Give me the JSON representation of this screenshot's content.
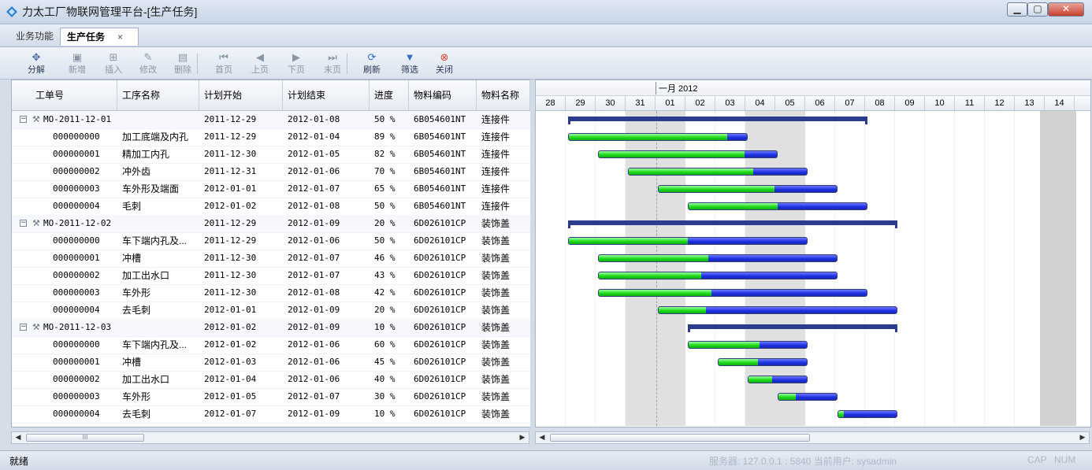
{
  "window": {
    "title": "力太工厂物联网管理平台-[生产任务]",
    "min": "▁",
    "max": "▢",
    "close": "✕"
  },
  "tabs": [
    {
      "label": "业务功能"
    },
    {
      "label": "生产任务",
      "close": "×"
    }
  ],
  "toolbar": [
    {
      "label": "分解",
      "icon": "split-icon",
      "enabled": true
    },
    {
      "label": "新增",
      "icon": "add-icon",
      "enabled": false
    },
    {
      "label": "插入",
      "icon": "insert-icon",
      "enabled": false
    },
    {
      "label": "修改",
      "icon": "edit-icon",
      "enabled": false
    },
    {
      "label": "删除",
      "icon": "delete-icon",
      "enabled": false
    },
    {
      "label": "首页",
      "icon": "first-page-icon",
      "enabled": false
    },
    {
      "label": "上页",
      "icon": "prev-page-icon",
      "enabled": false
    },
    {
      "label": "下页",
      "icon": "next-page-icon",
      "enabled": false
    },
    {
      "label": "末页",
      "icon": "last-page-icon",
      "enabled": false
    },
    {
      "label": "刷新",
      "icon": "refresh-icon",
      "enabled": true
    },
    {
      "label": "筛选",
      "icon": "filter-icon",
      "enabled": true
    },
    {
      "label": "关闭",
      "icon": "close-circle-icon",
      "enabled": true
    }
  ],
  "grid": {
    "columns": [
      "工单号",
      "工序名称",
      "计划开始",
      "计划结束",
      "进度",
      "物料编码",
      "物料名称"
    ],
    "rows": [
      {
        "type": "parent",
        "id": "MO-2011-12-01",
        "name": "",
        "start": "2011-12-29",
        "end": "2012-01-08",
        "progress": "50 %",
        "code": "6B054601NT",
        "material": "连接件",
        "s": 29,
        "e": 39,
        "pct": 50
      },
      {
        "type": "child",
        "id": "000000000",
        "name": "加工底端及内孔",
        "start": "2011-12-29",
        "end": "2012-01-04",
        "progress": "89 %",
        "code": "6B054601NT",
        "material": "连接件",
        "s": 29,
        "e": 35,
        "pct": 89
      },
      {
        "type": "child",
        "id": "000000001",
        "name": "精加工内孔",
        "start": "2011-12-30",
        "end": "2012-01-05",
        "progress": "82 %",
        "code": "6B054601NT",
        "material": "连接件",
        "s": 30,
        "e": 36,
        "pct": 82
      },
      {
        "type": "child",
        "id": "000000002",
        "name": "冲外齿",
        "start": "2011-12-31",
        "end": "2012-01-06",
        "progress": "70 %",
        "code": "6B054601NT",
        "material": "连接件",
        "s": 31,
        "e": 37,
        "pct": 70
      },
      {
        "type": "child",
        "id": "000000003",
        "name": "车外形及端面",
        "start": "2012-01-01",
        "end": "2012-01-07",
        "progress": "65 %",
        "code": "6B054601NT",
        "material": "连接件",
        "s": 32,
        "e": 38,
        "pct": 65
      },
      {
        "type": "child",
        "id": "000000004",
        "name": "毛刺",
        "start": "2012-01-02",
        "end": "2012-01-08",
        "progress": "50 %",
        "code": "6B054601NT",
        "material": "连接件",
        "s": 33,
        "e": 39,
        "pct": 50
      },
      {
        "type": "parent",
        "id": "MO-2011-12-02",
        "name": "",
        "start": "2011-12-29",
        "end": "2012-01-09",
        "progress": "20 %",
        "code": "6D026101CP",
        "material": "装饰盖",
        "s": 29,
        "e": 40,
        "pct": 20
      },
      {
        "type": "child",
        "id": "000000000",
        "name": "车下端内孔及...",
        "start": "2011-12-29",
        "end": "2012-01-06",
        "progress": "50 %",
        "code": "6D026101CP",
        "material": "装饰盖",
        "s": 29,
        "e": 37,
        "pct": 50
      },
      {
        "type": "child",
        "id": "000000001",
        "name": "冲槽",
        "start": "2011-12-30",
        "end": "2012-01-07",
        "progress": "46 %",
        "code": "6D026101CP",
        "material": "装饰盖",
        "s": 30,
        "e": 38,
        "pct": 46
      },
      {
        "type": "child",
        "id": "000000002",
        "name": "加工出水口",
        "start": "2011-12-30",
        "end": "2012-01-07",
        "progress": "43 %",
        "code": "6D026101CP",
        "material": "装饰盖",
        "s": 30,
        "e": 38,
        "pct": 43
      },
      {
        "type": "child",
        "id": "000000003",
        "name": "车外形",
        "start": "2011-12-30",
        "end": "2012-01-08",
        "progress": "42 %",
        "code": "6D026101CP",
        "material": "装饰盖",
        "s": 30,
        "e": 39,
        "pct": 42
      },
      {
        "type": "child",
        "id": "000000004",
        "name": "去毛刺",
        "start": "2012-01-01",
        "end": "2012-01-09",
        "progress": "20 %",
        "code": "6D026101CP",
        "material": "装饰盖",
        "s": 32,
        "e": 40,
        "pct": 20
      },
      {
        "type": "parent",
        "id": "MO-2011-12-03",
        "name": "",
        "start": "2012-01-02",
        "end": "2012-01-09",
        "progress": "10 %",
        "code": "6D026101CP",
        "material": "装饰盖",
        "s": 33,
        "e": 40,
        "pct": 10
      },
      {
        "type": "child",
        "id": "000000000",
        "name": "车下端内孔及...",
        "start": "2012-01-02",
        "end": "2012-01-06",
        "progress": "60 %",
        "code": "6D026101CP",
        "material": "装饰盖",
        "s": 33,
        "e": 37,
        "pct": 60
      },
      {
        "type": "child",
        "id": "000000001",
        "name": "冲槽",
        "start": "2012-01-03",
        "end": "2012-01-06",
        "progress": "45 %",
        "code": "6D026101CP",
        "material": "装饰盖",
        "s": 34,
        "e": 37,
        "pct": 45
      },
      {
        "type": "child",
        "id": "000000002",
        "name": "加工出水口",
        "start": "2012-01-04",
        "end": "2012-01-06",
        "progress": "40 %",
        "code": "6D026101CP",
        "material": "装饰盖",
        "s": 35,
        "e": 37,
        "pct": 40
      },
      {
        "type": "child",
        "id": "000000003",
        "name": "车外形",
        "start": "2012-01-05",
        "end": "2012-01-07",
        "progress": "30 %",
        "code": "6D026101CP",
        "material": "装饰盖",
        "s": 36,
        "e": 38,
        "pct": 30
      },
      {
        "type": "child",
        "id": "000000004",
        "name": "去毛刺",
        "start": "2012-01-07",
        "end": "2012-01-09",
        "progress": "10 %",
        "code": "6D026101CP",
        "material": "装饰盖",
        "s": 38,
        "e": 40,
        "pct": 10
      }
    ]
  },
  "gantt": {
    "month": "一月 2012",
    "days": [
      "28",
      "29",
      "30",
      "31",
      "01",
      "02",
      "03",
      "04",
      "05",
      "06",
      "07",
      "08",
      "09",
      "10",
      "11",
      "12",
      "13",
      "14"
    ],
    "first_day": 28,
    "weekend_start_days": [
      31,
      35
    ],
    "today_day": 32,
    "colors": {
      "done": "#18d818",
      "remaining": "#1c2ee0",
      "summary": "#2c3c8c",
      "weekend": "#e0e0e0"
    }
  },
  "scroll": {
    "left": "◀",
    "right": "▶",
    "thumb_mark": "III"
  },
  "status": {
    "text": "就绪",
    "server": "服务器: 127.0.0.1 : 5840  当前用户: sysadmin",
    "cap": "CAP",
    "num": "NUM"
  }
}
